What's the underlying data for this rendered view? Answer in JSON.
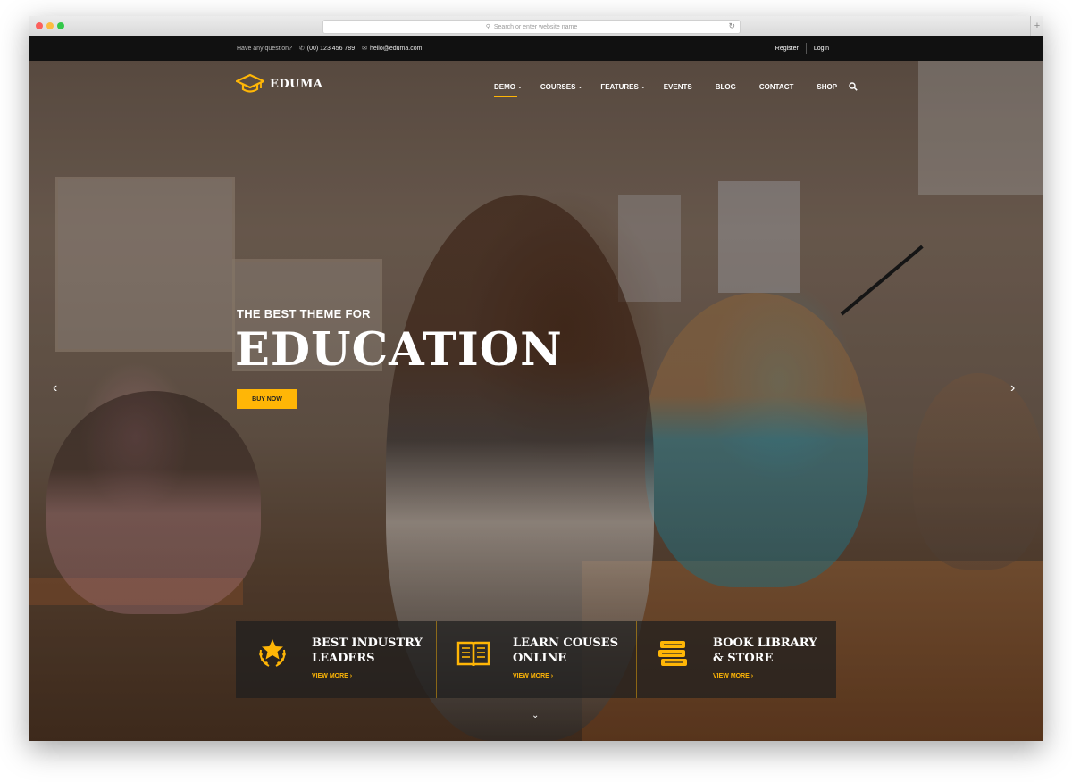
{
  "browser": {
    "url_placeholder": "Search or enter website name"
  },
  "topbar": {
    "question": "Have any question?",
    "phone": "(00) 123 456 789",
    "email": "hello@eduma.com",
    "register": "Register",
    "login": "Login"
  },
  "brand": {
    "name": "EDUMA"
  },
  "nav": {
    "items": [
      {
        "label": "DEMO",
        "has_dropdown": true
      },
      {
        "label": "COURSES",
        "has_dropdown": true
      },
      {
        "label": "FEATURES",
        "has_dropdown": true
      },
      {
        "label": "EVENTS",
        "has_dropdown": false
      },
      {
        "label": "BLOG",
        "has_dropdown": false
      },
      {
        "label": "CONTACT",
        "has_dropdown": false
      },
      {
        "label": "SHOP",
        "has_dropdown": false
      }
    ],
    "search_icon": "search-icon"
  },
  "hero": {
    "subtitle": "THE BEST THEME FOR",
    "title": "EDUCATION",
    "button": "BUY NOW"
  },
  "features": [
    {
      "title_line1": "BEST INDUSTRY",
      "title_line2": "LEADERS",
      "link": "VIEW MORE",
      "icon": "award-star-icon"
    },
    {
      "title_line1": "LEARN COUSES",
      "title_line2": "ONLINE",
      "link": "VIEW MORE",
      "icon": "open-book-icon"
    },
    {
      "title_line1": "BOOK LIBRARY",
      "title_line2": "& STORE",
      "link": "VIEW MORE",
      "icon": "book-stack-icon"
    }
  ],
  "colors": {
    "accent": "#ffb606",
    "topbar": "#111111"
  }
}
